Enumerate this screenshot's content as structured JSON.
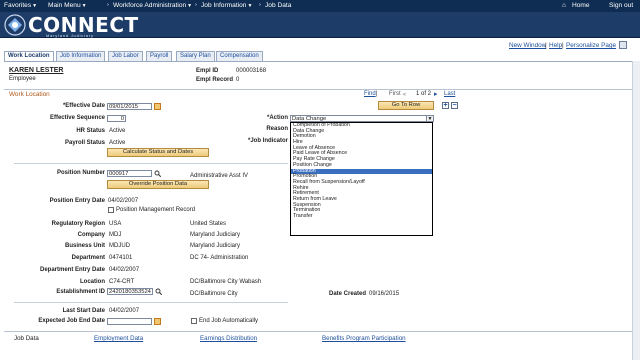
{
  "nav": {
    "favorites": "Favorites",
    "main_menu": "Main Menu",
    "breadcrumbs": [
      "Workforce Administration",
      "Job Information",
      "Job Data"
    ],
    "home": "Home",
    "signout": "Sign out"
  },
  "logo": {
    "text": "CONNECT",
    "sub": "Maryland Judiciary"
  },
  "toolbar": {
    "new_window": "New Window",
    "help": "Help",
    "personalize": "Personalize Page"
  },
  "tabs": [
    "Work Location",
    "Job Information",
    "Job Labor",
    "Payroll",
    "Salary Plan",
    "Compensation"
  ],
  "employee": {
    "name": "KAREN LESTER",
    "type": "Employee",
    "empl_id_label": "Empl ID",
    "empl_id": "000003168",
    "empl_record_label": "Empl Record",
    "empl_record": "0"
  },
  "section": {
    "title": "Work Location",
    "find": "Find",
    "first": "First",
    "counter": "1 of 2",
    "last": "Last"
  },
  "form": {
    "effective_date_label": "*Effective Date",
    "effective_date": "09/01/2015",
    "effective_seq_label": "Effective Sequence",
    "effective_seq": "0",
    "hr_status_label": "HR Status",
    "hr_status": "Active",
    "payroll_status_label": "Payroll Status",
    "payroll_status": "Active",
    "calc_button": "Calculate Status and Dates",
    "action_label": "*Action",
    "action_value": "Data Change",
    "reason_label": "Reason",
    "job_indicator_label": "*Job Indicator",
    "go_to_row": "Go To Row",
    "position_number_label": "Position Number",
    "position_number": "000917",
    "position_desc": "Administrative Asst IV",
    "override_button": "Override Position Data",
    "position_entry_label": "Position Entry Date",
    "position_entry": "04/02/2007",
    "position_mgmt": "Position Management Record",
    "reg_region_label": "Regulatory Region",
    "reg_region": "USA",
    "reg_region_desc": "United States",
    "company_label": "Company",
    "company": "MDJ",
    "company_desc": "Maryland Judiciary",
    "bu_label": "Business Unit",
    "bu": "MDJUD",
    "bu_desc": "Maryland Judiciary",
    "dept_label": "Department",
    "dept": "0474101",
    "dept_desc": "DC 74- Administration",
    "dept_entry_label": "Department Entry Date",
    "dept_entry": "04/02/2007",
    "location_label": "Location",
    "location": "C74-CRT",
    "location_desc": "DC/Baltimore City Wabash",
    "estab_label": "Establishment ID",
    "estab": "2420180353524",
    "estab_desc": "DC/Baltimore City",
    "date_created_label": "Date Created",
    "date_created": "09/16/2015",
    "last_start_label": "Last Start Date",
    "last_start": "04/02/2007",
    "expected_end_label": "Expected Job End Date",
    "end_auto": "End Job Automatically"
  },
  "action_options": [
    "Completion of Probation",
    "Data Change",
    "Demotion",
    "Hire",
    "Leave of Absence",
    "Paid Leave of Absence",
    "Pay Rate Change",
    "Position Change",
    "Probation",
    "Promotion",
    "Recall from Suspension/Layoff",
    "Rehire",
    "Retirement",
    "Return from Leave",
    "Suspension",
    "Termination",
    "Transfer"
  ],
  "selected_option": "Probation",
  "footer": {
    "links": [
      "Job Data",
      "Employment Data",
      "Earnings Distribution",
      "Benefits Program Participation"
    ]
  },
  "colors": {
    "nav": "#0f2d52",
    "header": "#1d3c68",
    "link": "#1d4f9c",
    "selected": "#3a6ebf",
    "section_title": "#b0561a"
  }
}
